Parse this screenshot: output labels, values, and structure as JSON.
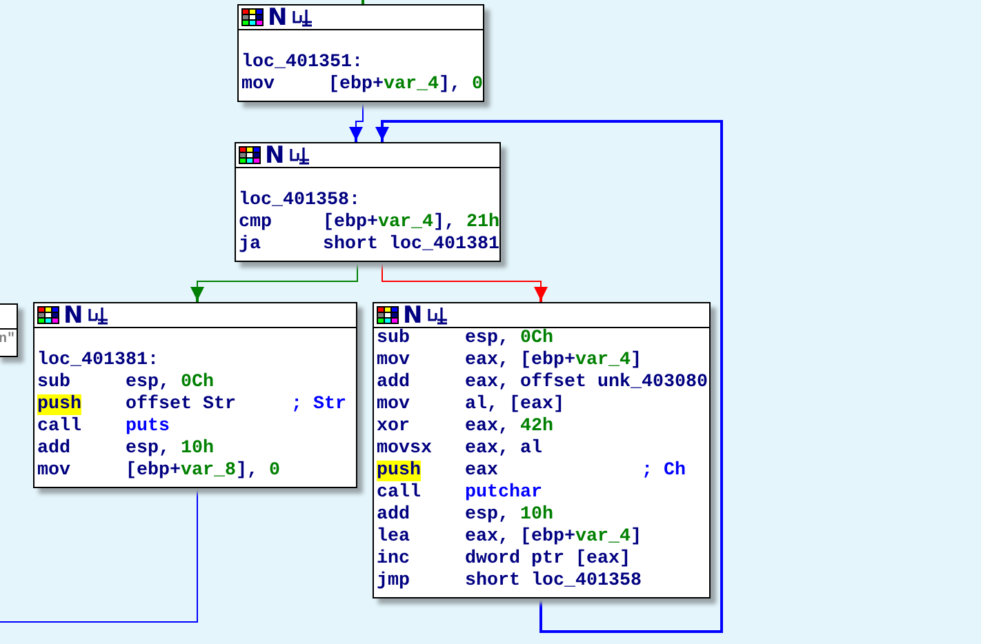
{
  "nodes": [
    {
      "header_mark": "N",
      "lines": [
        {
          "kind": "blank"
        },
        {
          "kind": "label",
          "text": "loc_401351:"
        },
        {
          "kind": "insn",
          "mnemonic": "mov",
          "highlighted": false,
          "operand": [
            {
              "kind": "plain",
              "text": "[ebp+"
            },
            {
              "kind": "var",
              "text": "var_4"
            },
            {
              "kind": "plain",
              "text": "], "
            },
            {
              "kind": "number",
              "text": "0"
            }
          ]
        }
      ]
    },
    {
      "header_mark": "N",
      "lines": [
        {
          "kind": "blank"
        },
        {
          "kind": "label",
          "text": "loc_401358:"
        },
        {
          "kind": "insn",
          "mnemonic": "cmp",
          "highlighted": false,
          "operand": [
            {
              "kind": "plain",
              "text": "[ebp+"
            },
            {
              "kind": "var",
              "text": "var_4"
            },
            {
              "kind": "plain",
              "text": "], "
            },
            {
              "kind": "number",
              "text": "21h"
            }
          ]
        },
        {
          "kind": "insn",
          "mnemonic": "ja",
          "highlighted": false,
          "operand": [
            {
              "kind": "plain",
              "text": "short loc_401381"
            }
          ]
        }
      ]
    },
    {
      "header_mark": "N",
      "lines": [
        {
          "kind": "blank"
        },
        {
          "kind": "label",
          "text": "loc_401381:"
        },
        {
          "kind": "insn",
          "mnemonic": "sub",
          "highlighted": false,
          "operand": [
            {
              "kind": "plain",
              "text": "esp, "
            },
            {
              "kind": "number",
              "text": "0Ch"
            }
          ]
        },
        {
          "kind": "insn",
          "mnemonic": "push",
          "highlighted": true,
          "operand": [
            {
              "kind": "plain",
              "text": "offset Str"
            }
          ],
          "comment": "; Str"
        },
        {
          "kind": "insn",
          "mnemonic": "call",
          "highlighted": false,
          "operand": [
            {
              "kind": "name",
              "text": "puts"
            }
          ]
        },
        {
          "kind": "insn",
          "mnemonic": "add",
          "highlighted": false,
          "operand": [
            {
              "kind": "plain",
              "text": "esp, "
            },
            {
              "kind": "number",
              "text": "10h"
            }
          ]
        },
        {
          "kind": "insn",
          "mnemonic": "mov",
          "highlighted": false,
          "operand": [
            {
              "kind": "plain",
              "text": "[ebp+"
            },
            {
              "kind": "var",
              "text": "var_8"
            },
            {
              "kind": "plain",
              "text": "], "
            },
            {
              "kind": "number",
              "text": "0"
            }
          ]
        }
      ]
    },
    {
      "header_mark": "N",
      "lines": [
        {
          "kind": "insn",
          "mnemonic": "sub",
          "highlighted": false,
          "operand": [
            {
              "kind": "plain",
              "text": "esp, "
            },
            {
              "kind": "number",
              "text": "0Ch"
            }
          ]
        },
        {
          "kind": "insn",
          "mnemonic": "mov",
          "highlighted": false,
          "operand": [
            {
              "kind": "plain",
              "text": "eax, [ebp+"
            },
            {
              "kind": "var",
              "text": "var_4"
            },
            {
              "kind": "plain",
              "text": "]"
            }
          ]
        },
        {
          "kind": "insn",
          "mnemonic": "add",
          "highlighted": false,
          "operand": [
            {
              "kind": "plain",
              "text": "eax, offset unk_403080"
            }
          ]
        },
        {
          "kind": "insn",
          "mnemonic": "mov",
          "highlighted": false,
          "operand": [
            {
              "kind": "plain",
              "text": "al, [eax]"
            }
          ]
        },
        {
          "kind": "insn",
          "mnemonic": "xor",
          "highlighted": false,
          "operand": [
            {
              "kind": "plain",
              "text": "eax, "
            },
            {
              "kind": "number",
              "text": "42h"
            }
          ]
        },
        {
          "kind": "insn",
          "mnemonic": "movsx",
          "highlighted": false,
          "operand": [
            {
              "kind": "plain",
              "text": "eax, al"
            }
          ]
        },
        {
          "kind": "insn",
          "mnemonic": "push",
          "highlighted": true,
          "operand": [
            {
              "kind": "plain",
              "text": "eax"
            }
          ],
          "comment": "; Ch"
        },
        {
          "kind": "insn",
          "mnemonic": "call",
          "highlighted": false,
          "operand": [
            {
              "kind": "name",
              "text": "putchar"
            }
          ]
        },
        {
          "kind": "insn",
          "mnemonic": "add",
          "highlighted": false,
          "operand": [
            {
              "kind": "plain",
              "text": "esp, "
            },
            {
              "kind": "number",
              "text": "10h"
            }
          ]
        },
        {
          "kind": "insn",
          "mnemonic": "lea",
          "highlighted": false,
          "operand": [
            {
              "kind": "plain",
              "text": "eax, [ebp+"
            },
            {
              "kind": "var",
              "text": "var_4"
            },
            {
              "kind": "plain",
              "text": "]"
            }
          ]
        },
        {
          "kind": "insn",
          "mnemonic": "inc",
          "highlighted": false,
          "operand": [
            {
              "kind": "plain",
              "text": "dword ptr [eax]"
            }
          ]
        },
        {
          "kind": "insn",
          "mnemonic": "jmp",
          "highlighted": false,
          "operand": [
            {
              "kind": "plain",
              "text": "short loc_401358"
            }
          ]
        }
      ]
    },
    {
      "lines": [
        {
          "kind": "fragment",
          "text": "n\""
        }
      ]
    }
  ],
  "edges": [
    {
      "color": "#008000"
    },
    {
      "color": "#0000ff"
    },
    {
      "color": "#008000"
    },
    {
      "color": "#ff0000"
    },
    {
      "color": "#0000ff"
    },
    {
      "color": "#0000ff"
    }
  ]
}
